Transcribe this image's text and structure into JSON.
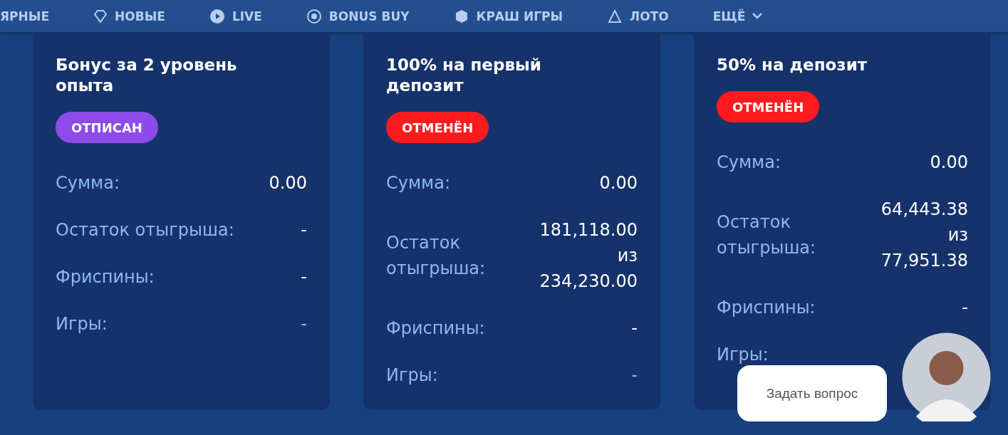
{
  "nav": {
    "items": [
      {
        "label": "ЯРНЫЕ"
      },
      {
        "label": "НОВЫЕ"
      },
      {
        "label": "LIVE"
      },
      {
        "label": "BONUS BUY"
      },
      {
        "label": "КРАШ ИГРЫ"
      },
      {
        "label": "ЛОТО"
      },
      {
        "label": "ЕЩЁ"
      }
    ]
  },
  "cards": [
    {
      "title": "Бонус за 2 уровень опыта",
      "status": {
        "label": "ОТПИСАН",
        "kind": "unsubscribed"
      },
      "rows": [
        {
          "label": "Сумма:",
          "value": "0.00"
        },
        {
          "label": "Остаток отыгрыша:",
          "value": "-"
        },
        {
          "label": "Фриспины:",
          "value": "-"
        },
        {
          "label": "Игры:",
          "value": "-",
          "kind": "link"
        }
      ]
    },
    {
      "title": "100% на первый депозит",
      "status": {
        "label": "ОТМЕНЁН",
        "kind": "cancelled"
      },
      "rows": [
        {
          "label": "Сумма:",
          "value": "0.00"
        },
        {
          "label": "Остаток отыгрыша:",
          "value": "181,118.00 из 234,230.00"
        },
        {
          "label": "Фриспины:",
          "value": "-"
        },
        {
          "label": "Игры:",
          "value": "-",
          "kind": "link"
        }
      ]
    },
    {
      "title": "50% на депозит",
      "status": {
        "label": "ОТМЕНЁН",
        "kind": "cancelled"
      },
      "rows": [
        {
          "label": "Сумма:",
          "value": "0.00"
        },
        {
          "label": "Остаток отыгрыша:",
          "value": "64,443.38 из 77,951.38"
        },
        {
          "label": "Фриспины:",
          "value": "-"
        },
        {
          "label": "Игры:"
        }
      ]
    }
  ],
  "chat": {
    "label": "Задать вопрос"
  }
}
